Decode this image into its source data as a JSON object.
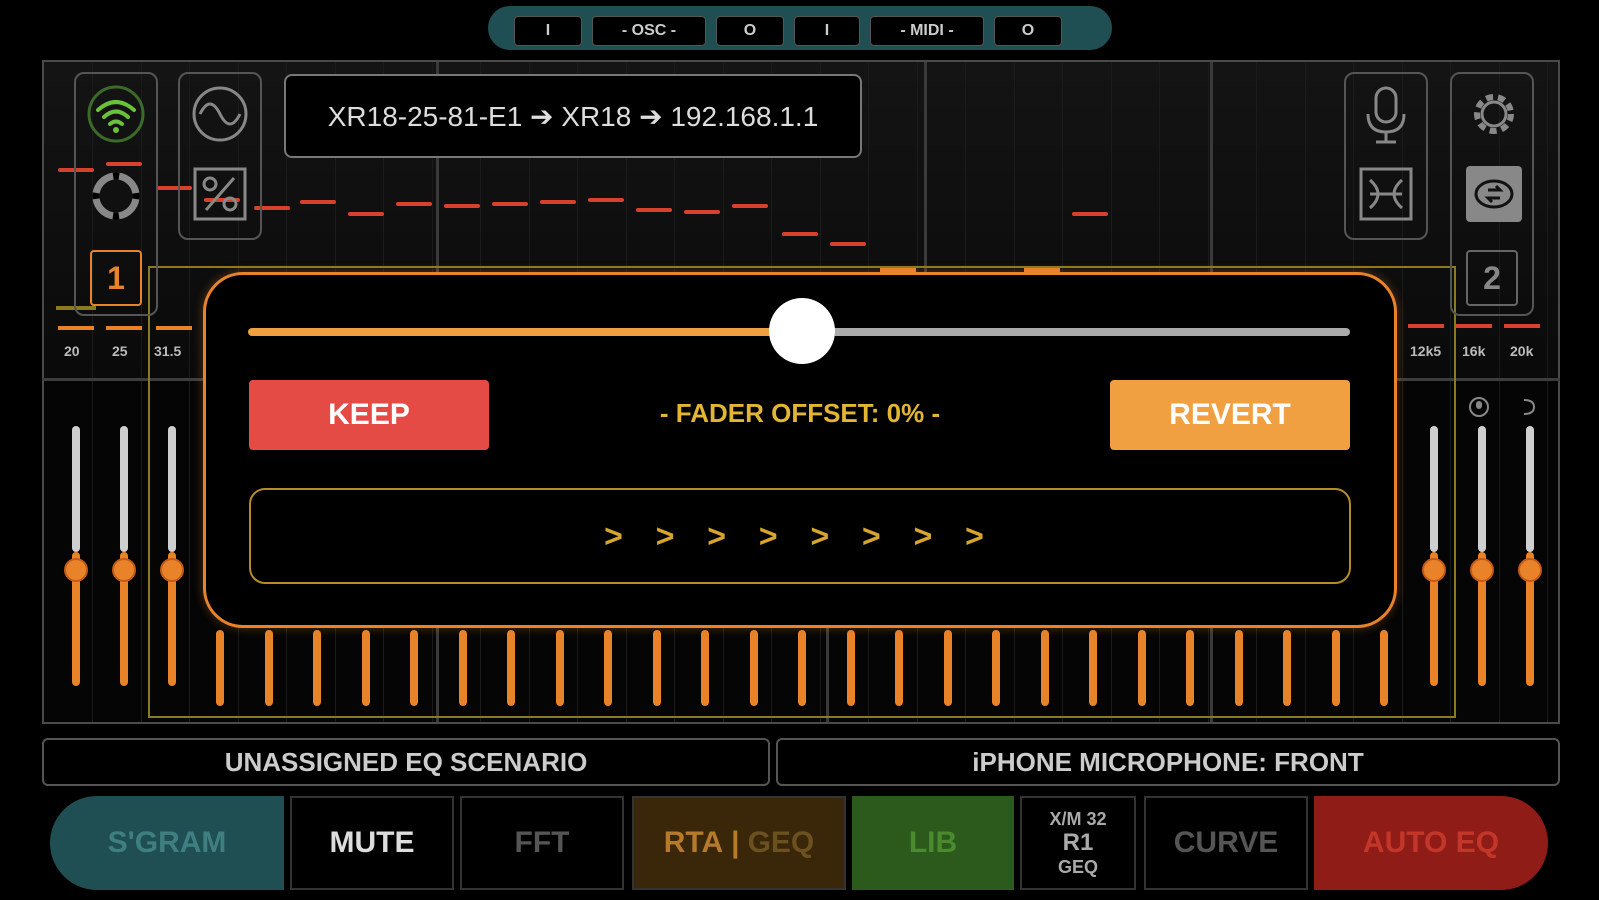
{
  "top_bar": {
    "items": [
      "I",
      "- OSC -",
      "O",
      "I",
      "- MIDI -",
      "O"
    ]
  },
  "connection": {
    "path": "XR18-25-81-E1 ➔ XR18 ➔ 192.168.1.1"
  },
  "left_panel": {
    "wifi_icon": "wifi-icon",
    "lifebuoy_icon": "lifebuoy-icon",
    "sine_icon": "sine-wave-icon",
    "percent_icon": "percent-icon",
    "channel_label": "1"
  },
  "right_panel": {
    "mic_icon": "microphone-icon",
    "arrows_icon": "expand-arrows-icon",
    "gear_icon": "gear-icon",
    "swap_icon": "swap-icon",
    "channel_label": "2"
  },
  "frequency_labels": {
    "left": [
      "20",
      "25",
      "31.5"
    ],
    "right": [
      "12k5",
      "16k",
      "20k"
    ]
  },
  "right_fader_icons": [
    "mic-small-icon",
    "speaker-small-icon"
  ],
  "modal": {
    "slider_value_percent": 50,
    "keep_label": "KEEP",
    "revert_label": "REVERT",
    "fader_offset_text": "- FADER OFFSET: 0% -",
    "progress_text": "> > > > > > > >"
  },
  "scenario_bar": {
    "left": "UNASSIGNED EQ SCENARIO",
    "right": "iPHONE MICROPHONE: FRONT"
  },
  "bottom_bar": {
    "sgram": "S'GRAM",
    "mute": "MUTE",
    "fft": "FFT",
    "rta": "RTA",
    "rta_sep": "|",
    "geq": "GEQ",
    "lib": "LIB",
    "xm_top": "X/M 32",
    "xm_mid": "R1",
    "xm_bot": "GEQ",
    "curve": "CURVE",
    "auto_eq": "AUTO EQ"
  },
  "colors": {
    "accent_orange": "#e8832a",
    "keep_red": "#e54b45",
    "revert_orange": "#f0a040",
    "text_yellow": "#e2b533",
    "sgram_teal": "#1f4f52",
    "lib_green": "#2b5a1c",
    "auto_eq_red": "#8f1c16"
  }
}
